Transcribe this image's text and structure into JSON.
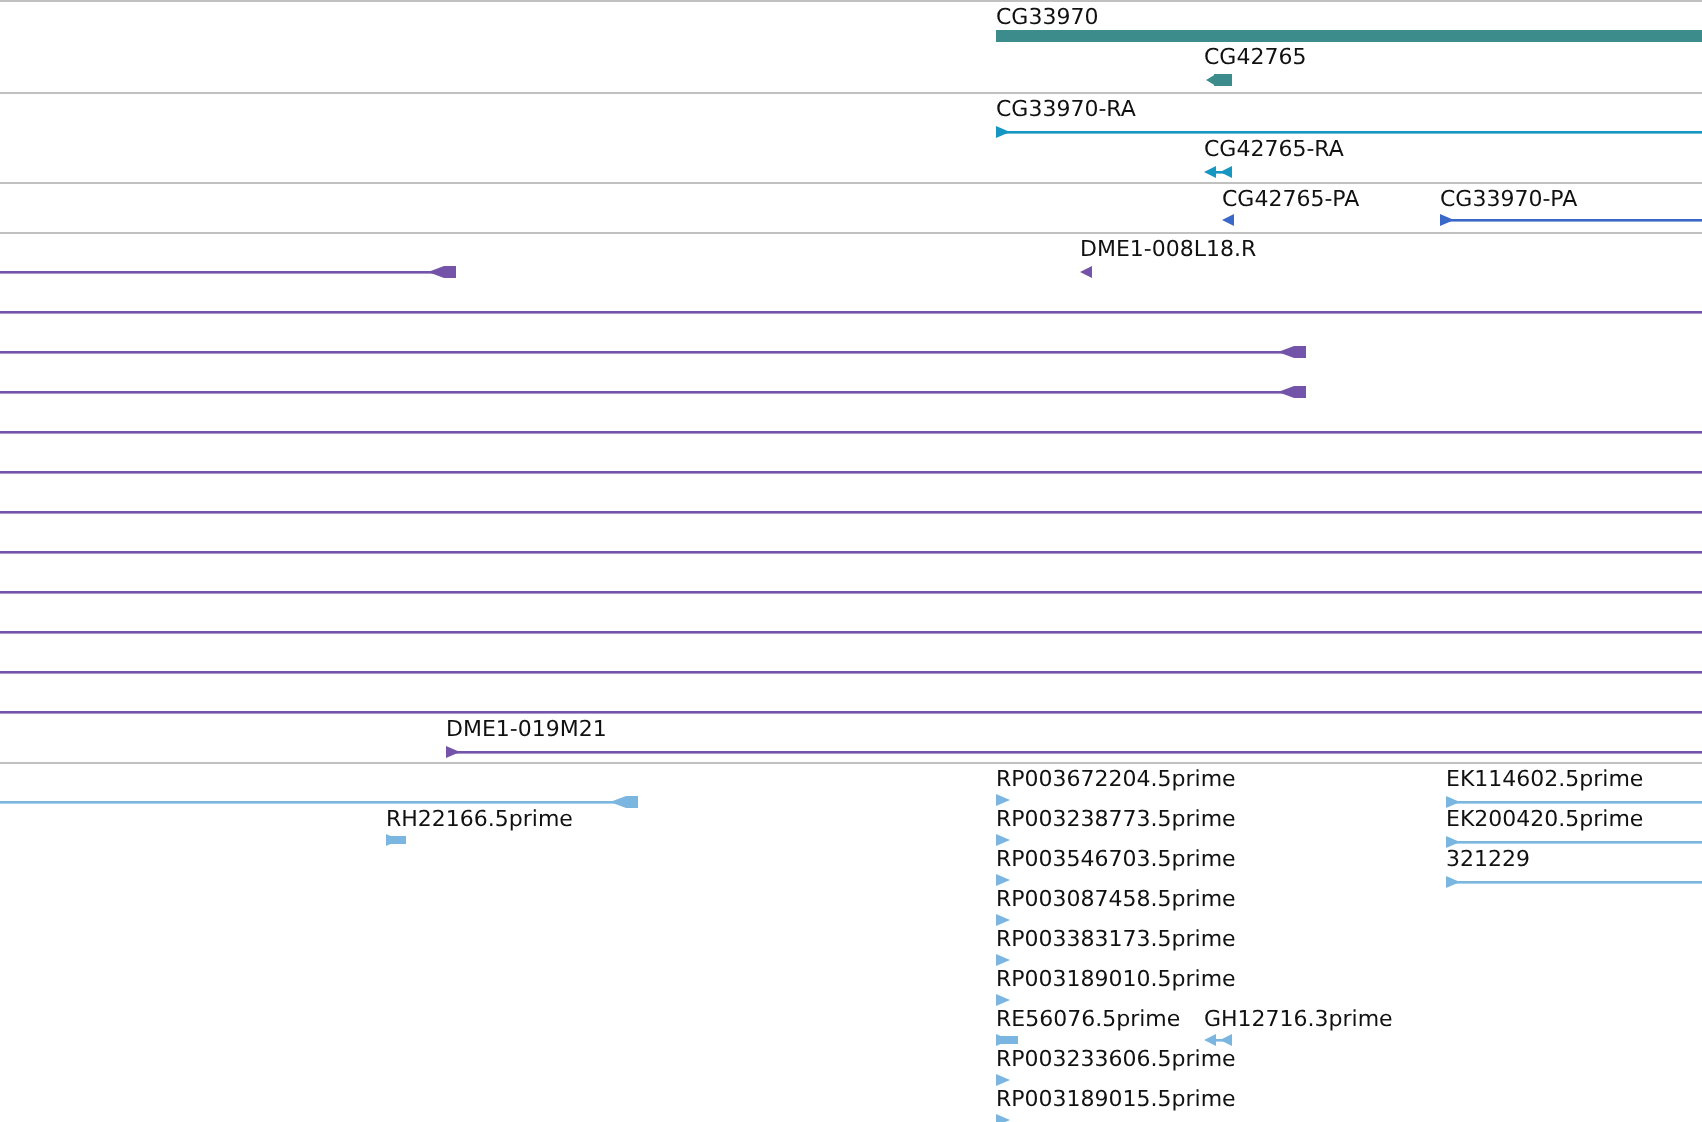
{
  "tracks": [
    {
      "kind": "gene",
      "features": [
        {
          "label": "CG33970",
          "kind": "bar",
          "reverse": false
        },
        {
          "label": "CG42765",
          "kind": "bar",
          "reverse": true
        }
      ]
    },
    {
      "kind": "transcript",
      "features": [
        {
          "label": "CG33970-RA",
          "kind": "line",
          "reverse": false
        },
        {
          "label": "CG42765-RA",
          "kind": "arrow",
          "reverse": true
        }
      ]
    },
    {
      "kind": "protein",
      "features": [
        {
          "label": "CG42765-PA",
          "kind": "arrow",
          "reverse": true
        },
        {
          "label": "CG33970-PA",
          "kind": "line",
          "reverse": false
        }
      ]
    },
    {
      "kind": "clone",
      "features": [
        {
          "kind": "line",
          "reverse": true
        },
        {
          "label": "DME1-008L18.R",
          "kind": "arrow",
          "reverse": true
        },
        {
          "kind": "rule"
        },
        {
          "kind": "line",
          "reverse": true
        },
        {
          "kind": "line",
          "reverse": true
        },
        {
          "kind": "rule"
        },
        {
          "kind": "rule"
        },
        {
          "kind": "rule"
        },
        {
          "kind": "rule"
        },
        {
          "kind": "rule"
        },
        {
          "kind": "rule"
        },
        {
          "kind": "rule"
        },
        {
          "kind": "rule"
        },
        {
          "label": "DME1-019M21",
          "kind": "line",
          "reverse": false
        }
      ]
    },
    {
      "kind": "est",
      "features": [
        {
          "label": "RP003672204.5prime",
          "kind": "arrow",
          "reverse": false
        },
        {
          "label": "EK114602.5prime",
          "kind": "line",
          "reverse": false
        },
        {
          "kind": "line",
          "reverse": true
        },
        {
          "label": "RH22166.5prime",
          "kind": "arrow",
          "reverse": false
        },
        {
          "label": "RP003238773.5prime",
          "kind": "arrow",
          "reverse": false
        },
        {
          "label": "EK200420.5prime",
          "kind": "line",
          "reverse": false
        },
        {
          "label": "RP003546703.5prime",
          "kind": "arrow",
          "reverse": false
        },
        {
          "label": "321229",
          "kind": "line",
          "reverse": false
        },
        {
          "label": "RP003087458.5prime",
          "kind": "arrow",
          "reverse": false
        },
        {
          "label": "RP003383173.5prime",
          "kind": "arrow",
          "reverse": false
        },
        {
          "label": "RP003189010.5prime",
          "kind": "arrow",
          "reverse": false
        },
        {
          "label": "RE56076.5prime",
          "kind": "arrow",
          "reverse": false
        },
        {
          "label": "GH12716.3prime",
          "kind": "arrow",
          "reverse": true
        },
        {
          "label": "RP003233606.5prime",
          "kind": "arrow",
          "reverse": false
        },
        {
          "label": "RP003189015.5prime",
          "kind": "arrow",
          "reverse": false
        }
      ]
    }
  ]
}
